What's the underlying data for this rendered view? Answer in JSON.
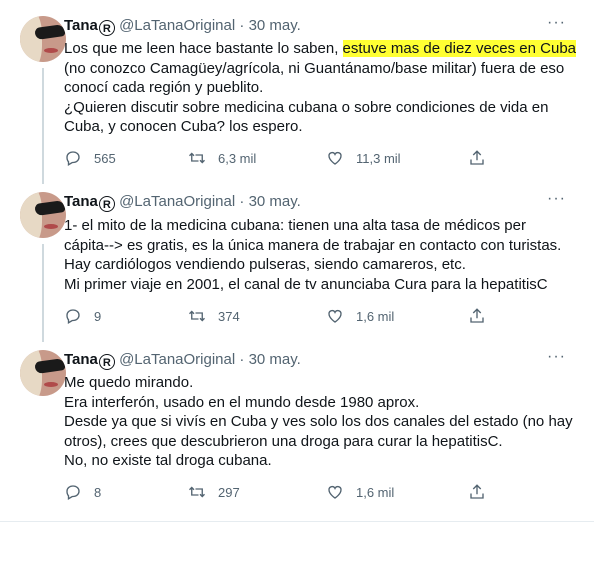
{
  "tweets": [
    {
      "name": "Tana",
      "badge": "R",
      "handle": "@LaTanaOriginal",
      "date": "30 may.",
      "lines_pre": "Los que me leen hace bastante lo saben, ",
      "highlight": "estuve mas de diez veces en Cuba",
      "lines": [
        "(no conozco Camagüey/agrícola, ni Guantánamo/base militar) fuera de eso",
        "conocí cada región y pueblito.",
        "¿Quieren discutir sobre medicina cubana o sobre condiciones de vida en",
        "Cuba, y conocen Cuba? los espero."
      ],
      "replies": "565",
      "retweets": "6,3 mil",
      "likes": "11,3 mil"
    },
    {
      "name": "Tana",
      "badge": "R",
      "handle": "@LaTanaOriginal",
      "date": "30 may.",
      "lines": [
        "1- el mito de la medicina cubana: tienen una alta tasa de médicos per",
        "cápita--> es gratis, es la única manera de trabajar en contacto con turistas.",
        "Hay cardiólogos vendiendo pulseras, siendo camareros, etc.",
        "Mi primer viaje en 2001, el canal de tv anunciaba Cura para la hepatitisC"
      ],
      "replies": "9",
      "retweets": "374",
      "likes": "1,6 mil"
    },
    {
      "name": "Tana",
      "badge": "R",
      "handle": "@LaTanaOriginal",
      "date": "30 may.",
      "lines": [
        "Me quedo mirando.",
        "Era interferón, usado en el mundo desde 1980 aprox.",
        "Desde ya que si vivís en Cuba y ves solo los dos canales del estado (no hay",
        "otros), crees que descubrieron una droga para curar la hepatitisC.",
        "No, no existe tal droga cubana."
      ],
      "replies": "8",
      "retweets": "297",
      "likes": "1,6 mil"
    }
  ],
  "icons": [
    "reply-icon",
    "retweet-icon",
    "like-icon",
    "share-icon",
    "more-icon"
  ],
  "colors": {
    "highlight": "#ffff33",
    "muted": "#536471",
    "text": "#0f1419"
  }
}
